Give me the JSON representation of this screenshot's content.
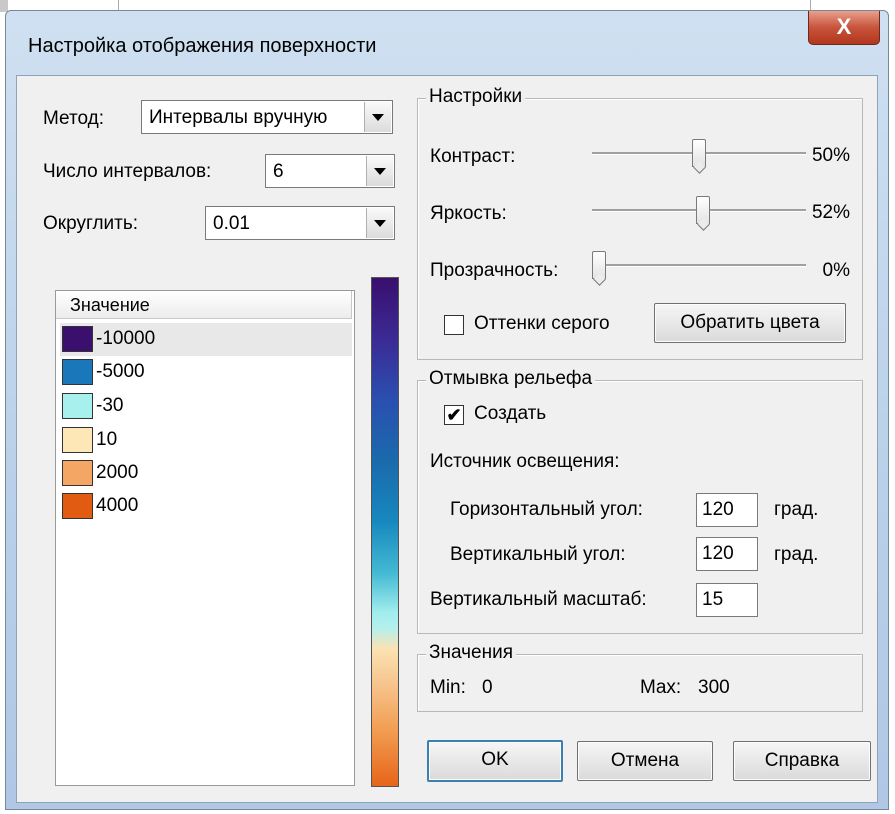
{
  "window": {
    "title": "Настройка отображения поверхности",
    "close_label": "X"
  },
  "method": {
    "label": "Метод:",
    "value": "Интервалы вручную"
  },
  "intervals": {
    "label": "Число интервалов:",
    "value": "6"
  },
  "rounding": {
    "label": "Округлить:",
    "value": "0.01"
  },
  "legend": {
    "header": "Значение",
    "items": [
      {
        "label": "-10000",
        "color": "#3a0f6e"
      },
      {
        "label": "-5000",
        "color": "#1a77b9"
      },
      {
        "label": "-30",
        "color": "#a8f0ee"
      },
      {
        "label": "10",
        "color": "#fde7b6"
      },
      {
        "label": "2000",
        "color": "#f4a664"
      },
      {
        "label": "4000",
        "color": "#e15b12"
      }
    ]
  },
  "settings": {
    "title": "Настройки",
    "contrast": {
      "label": "Контраст:",
      "value_text": "50%",
      "level": 0.5
    },
    "brightness": {
      "label": "Яркость:",
      "value_text": "52%",
      "level": 0.52
    },
    "transparency": {
      "label": "Прозрачность:",
      "value_text": "0%",
      "level": 0.0
    },
    "grayscale": {
      "label": "Оттенки серого",
      "checked": false
    },
    "invert_button": "Обратить цвета"
  },
  "hillshade": {
    "title": "Отмывка рельефа",
    "create": {
      "label": "Создать",
      "checked": true
    },
    "light_source_label": "Источник освещения:",
    "horizontal_angle": {
      "label": "Горизонтальный угол:",
      "value": "120",
      "unit": "град."
    },
    "vertical_angle": {
      "label": "Вертикальный угол:",
      "value": "120",
      "unit": "град."
    },
    "vertical_scale": {
      "label": "Вертикальный масштаб:",
      "value": "15"
    }
  },
  "values": {
    "title": "Значения",
    "min_label": "Min:",
    "min_value": "0",
    "max_label": "Max:",
    "max_value": "300"
  },
  "buttons": {
    "ok": "OK",
    "cancel": "Отмена",
    "help": "Справка"
  }
}
